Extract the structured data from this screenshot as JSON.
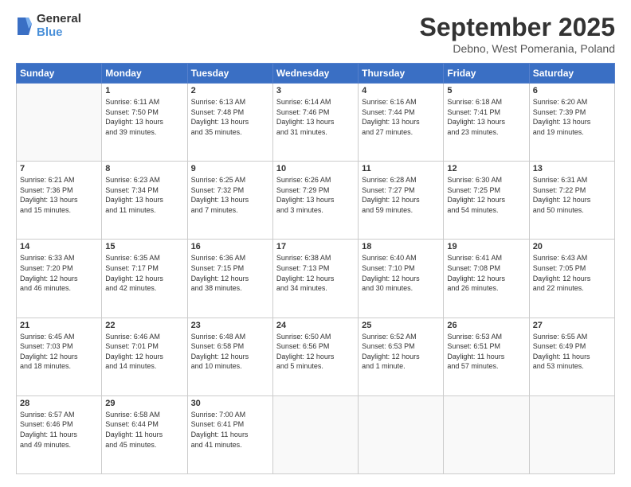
{
  "header": {
    "logo": {
      "line1": "General",
      "line2": "Blue"
    },
    "title": "September 2025",
    "location": "Debno, West Pomerania, Poland"
  },
  "weekdays": [
    "Sunday",
    "Monday",
    "Tuesday",
    "Wednesday",
    "Thursday",
    "Friday",
    "Saturday"
  ],
  "weeks": [
    [
      {
        "day": "",
        "info": ""
      },
      {
        "day": "1",
        "info": "Sunrise: 6:11 AM\nSunset: 7:50 PM\nDaylight: 13 hours\nand 39 minutes."
      },
      {
        "day": "2",
        "info": "Sunrise: 6:13 AM\nSunset: 7:48 PM\nDaylight: 13 hours\nand 35 minutes."
      },
      {
        "day": "3",
        "info": "Sunrise: 6:14 AM\nSunset: 7:46 PM\nDaylight: 13 hours\nand 31 minutes."
      },
      {
        "day": "4",
        "info": "Sunrise: 6:16 AM\nSunset: 7:44 PM\nDaylight: 13 hours\nand 27 minutes."
      },
      {
        "day": "5",
        "info": "Sunrise: 6:18 AM\nSunset: 7:41 PM\nDaylight: 13 hours\nand 23 minutes."
      },
      {
        "day": "6",
        "info": "Sunrise: 6:20 AM\nSunset: 7:39 PM\nDaylight: 13 hours\nand 19 minutes."
      }
    ],
    [
      {
        "day": "7",
        "info": "Sunrise: 6:21 AM\nSunset: 7:36 PM\nDaylight: 13 hours\nand 15 minutes."
      },
      {
        "day": "8",
        "info": "Sunrise: 6:23 AM\nSunset: 7:34 PM\nDaylight: 13 hours\nand 11 minutes."
      },
      {
        "day": "9",
        "info": "Sunrise: 6:25 AM\nSunset: 7:32 PM\nDaylight: 13 hours\nand 7 minutes."
      },
      {
        "day": "10",
        "info": "Sunrise: 6:26 AM\nSunset: 7:29 PM\nDaylight: 13 hours\nand 3 minutes."
      },
      {
        "day": "11",
        "info": "Sunrise: 6:28 AM\nSunset: 7:27 PM\nDaylight: 12 hours\nand 59 minutes."
      },
      {
        "day": "12",
        "info": "Sunrise: 6:30 AM\nSunset: 7:25 PM\nDaylight: 12 hours\nand 54 minutes."
      },
      {
        "day": "13",
        "info": "Sunrise: 6:31 AM\nSunset: 7:22 PM\nDaylight: 12 hours\nand 50 minutes."
      }
    ],
    [
      {
        "day": "14",
        "info": "Sunrise: 6:33 AM\nSunset: 7:20 PM\nDaylight: 12 hours\nand 46 minutes."
      },
      {
        "day": "15",
        "info": "Sunrise: 6:35 AM\nSunset: 7:17 PM\nDaylight: 12 hours\nand 42 minutes."
      },
      {
        "day": "16",
        "info": "Sunrise: 6:36 AM\nSunset: 7:15 PM\nDaylight: 12 hours\nand 38 minutes."
      },
      {
        "day": "17",
        "info": "Sunrise: 6:38 AM\nSunset: 7:13 PM\nDaylight: 12 hours\nand 34 minutes."
      },
      {
        "day": "18",
        "info": "Sunrise: 6:40 AM\nSunset: 7:10 PM\nDaylight: 12 hours\nand 30 minutes."
      },
      {
        "day": "19",
        "info": "Sunrise: 6:41 AM\nSunset: 7:08 PM\nDaylight: 12 hours\nand 26 minutes."
      },
      {
        "day": "20",
        "info": "Sunrise: 6:43 AM\nSunset: 7:05 PM\nDaylight: 12 hours\nand 22 minutes."
      }
    ],
    [
      {
        "day": "21",
        "info": "Sunrise: 6:45 AM\nSunset: 7:03 PM\nDaylight: 12 hours\nand 18 minutes."
      },
      {
        "day": "22",
        "info": "Sunrise: 6:46 AM\nSunset: 7:01 PM\nDaylight: 12 hours\nand 14 minutes."
      },
      {
        "day": "23",
        "info": "Sunrise: 6:48 AM\nSunset: 6:58 PM\nDaylight: 12 hours\nand 10 minutes."
      },
      {
        "day": "24",
        "info": "Sunrise: 6:50 AM\nSunset: 6:56 PM\nDaylight: 12 hours\nand 5 minutes."
      },
      {
        "day": "25",
        "info": "Sunrise: 6:52 AM\nSunset: 6:53 PM\nDaylight: 12 hours\nand 1 minute."
      },
      {
        "day": "26",
        "info": "Sunrise: 6:53 AM\nSunset: 6:51 PM\nDaylight: 11 hours\nand 57 minutes."
      },
      {
        "day": "27",
        "info": "Sunrise: 6:55 AM\nSunset: 6:49 PM\nDaylight: 11 hours\nand 53 minutes."
      }
    ],
    [
      {
        "day": "28",
        "info": "Sunrise: 6:57 AM\nSunset: 6:46 PM\nDaylight: 11 hours\nand 49 minutes."
      },
      {
        "day": "29",
        "info": "Sunrise: 6:58 AM\nSunset: 6:44 PM\nDaylight: 11 hours\nand 45 minutes."
      },
      {
        "day": "30",
        "info": "Sunrise: 7:00 AM\nSunset: 6:41 PM\nDaylight: 11 hours\nand 41 minutes."
      },
      {
        "day": "",
        "info": ""
      },
      {
        "day": "",
        "info": ""
      },
      {
        "day": "",
        "info": ""
      },
      {
        "day": "",
        "info": ""
      }
    ]
  ]
}
